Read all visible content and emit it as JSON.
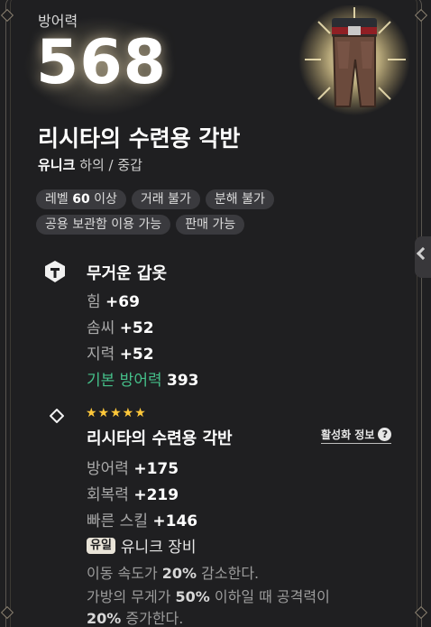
{
  "header": {
    "defense_label": "방어력",
    "defense_value": "568"
  },
  "item": {
    "name": "리시타의 수련용 각반",
    "rarity": "유니크",
    "type": "하의 / 중갑",
    "art_icon": "pants-icon"
  },
  "tags": {
    "row1": [
      {
        "pre": "레벨 ",
        "bold": "60",
        "post": " 이상"
      },
      {
        "pre": "거래 불가",
        "bold": "",
        "post": ""
      },
      {
        "pre": "분해 불가",
        "bold": "",
        "post": ""
      }
    ],
    "row2": [
      {
        "pre": "공용 보관함 이용 가능",
        "bold": "",
        "post": ""
      },
      {
        "pre": "판매 가능",
        "bold": "",
        "post": ""
      }
    ]
  },
  "armor_section": {
    "icon": "armor-icon",
    "title": "무거운 갑옷",
    "stats": [
      {
        "label": "힘 ",
        "value": "+69"
      },
      {
        "label": "솜씨 ",
        "value": "+52"
      },
      {
        "label": "지력 ",
        "value": "+52"
      },
      {
        "label": "기본 방어력 ",
        "value": "393"
      }
    ]
  },
  "set_section": {
    "icon": "diamond-icon",
    "stars": "★★★★★",
    "title": "리시타의 수련용 각반",
    "activation_label": "활성화 정보",
    "activation_icon": "question-icon",
    "stats": [
      {
        "label": "방어력 ",
        "value": "+175"
      },
      {
        "label": "회복력 ",
        "value": "+219"
      },
      {
        "label": "빠른 스킬 ",
        "value": "+146"
      }
    ],
    "unique_badge": "유일",
    "unique_text": "유니크 장비",
    "desc1_pre": "이동 속도가 ",
    "desc1_bold": "20%",
    "desc1_post": " 감소한다.",
    "desc2_pre": "가방의 무게가 ",
    "desc2_bold": "50%",
    "desc2_post": " 이하일 때 공격력이",
    "desc3_bold": "20%",
    "desc3_post": " 증가한다."
  },
  "colors": {
    "accent_green": "#45c08a",
    "star_gold": "#ffc83a"
  }
}
